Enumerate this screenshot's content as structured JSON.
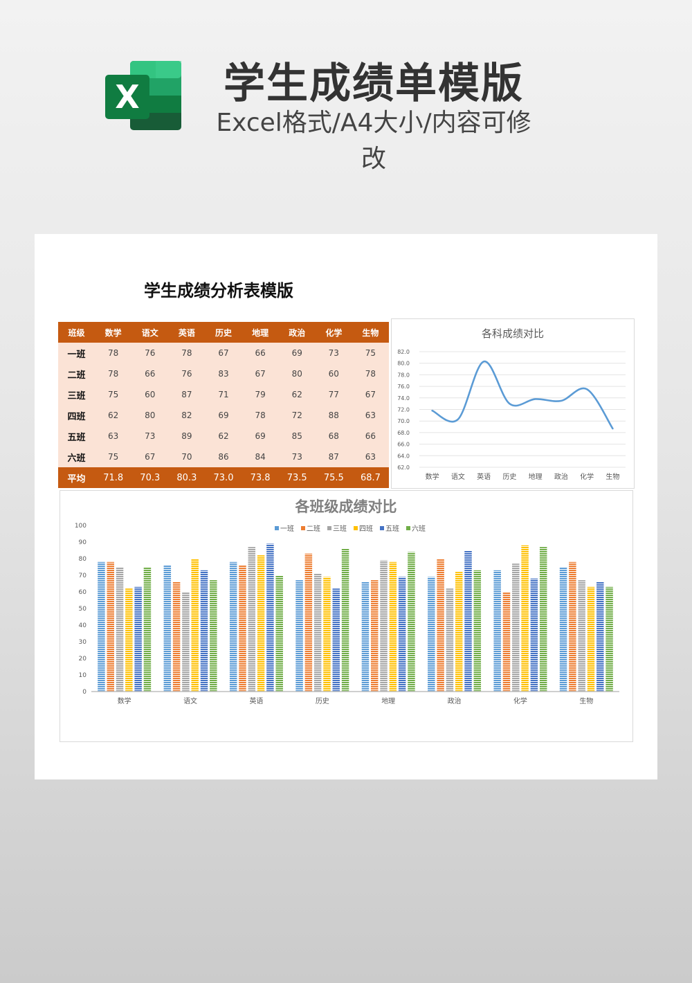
{
  "header": {
    "title": "学生成绩单模版",
    "subtitle": "Excel格式/A4大小/内容可修改",
    "logo_letter": "X",
    "logo_icon": "excel-logo-icon",
    "colors": {
      "dark_green": "#1e7145",
      "mid_green": "#21a366",
      "light_green": "#33c481"
    }
  },
  "sheet": {
    "title": "学生成绩分析表模版"
  },
  "table": {
    "header_bg": "#c55a11",
    "body_bg": "#fbe3d6",
    "columns": [
      "班级",
      "数学",
      "语文",
      "英语",
      "历史",
      "地理",
      "政治",
      "化学",
      "生物"
    ],
    "rows": [
      {
        "name": "一班",
        "values": [
          "78",
          "76",
          "78",
          "67",
          "66",
          "69",
          "73",
          "75"
        ]
      },
      {
        "name": "二班",
        "values": [
          "78",
          "66",
          "76",
          "83",
          "67",
          "80",
          "60",
          "78"
        ]
      },
      {
        "name": "三班",
        "values": [
          "75",
          "60",
          "87",
          "71",
          "79",
          "62",
          "77",
          "67"
        ]
      },
      {
        "name": "四班",
        "values": [
          "62",
          "80",
          "82",
          "69",
          "78",
          "72",
          "88",
          "63"
        ]
      },
      {
        "name": "五班",
        "values": [
          "63",
          "73",
          "89",
          "62",
          "69",
          "85",
          "68",
          "66"
        ]
      },
      {
        "name": "六班",
        "values": [
          "75",
          "67",
          "70",
          "86",
          "84",
          "73",
          "87",
          "63"
        ]
      }
    ],
    "average": {
      "name": "平均",
      "values": [
        "71.8",
        "70.3",
        "80.3",
        "73.0",
        "73.8",
        "73.5",
        "75.5",
        "68.7"
      ]
    }
  },
  "chart_data": [
    {
      "type": "line",
      "title": "各科成绩对比",
      "categories": [
        "数学",
        "语文",
        "英语",
        "历史",
        "地理",
        "政治",
        "化学",
        "生物"
      ],
      "values": [
        71.8,
        70.3,
        80.3,
        73.0,
        73.8,
        73.5,
        75.5,
        68.7
      ],
      "ylim": [
        62,
        82
      ],
      "yticks": [
        "82.0",
        "80.0",
        "78.0",
        "76.0",
        "74.0",
        "72.0",
        "70.0",
        "68.0",
        "66.0",
        "64.0",
        "62.0"
      ],
      "smooth": true,
      "grid": true,
      "legend": "none",
      "color": "#5b9bd5"
    },
    {
      "type": "bar",
      "title": "各班级成绩对比",
      "categories": [
        "数学",
        "语文",
        "英语",
        "历史",
        "地理",
        "政治",
        "化学",
        "生物"
      ],
      "series": [
        {
          "name": "一班",
          "color": "#5b9bd5",
          "values": [
            78,
            76,
            78,
            67,
            66,
            69,
            73,
            75
          ]
        },
        {
          "name": "二班",
          "color": "#ed7d31",
          "values": [
            78,
            66,
            76,
            83,
            67,
            80,
            60,
            78
          ]
        },
        {
          "name": "三班",
          "color": "#a5a5a5",
          "values": [
            75,
            60,
            87,
            71,
            79,
            62,
            77,
            67
          ]
        },
        {
          "name": "四班",
          "color": "#ffc000",
          "values": [
            62,
            80,
            82,
            69,
            78,
            72,
            88,
            63
          ]
        },
        {
          "name": "五班",
          "color": "#4472c4",
          "values": [
            63,
            73,
            89,
            62,
            69,
            85,
            68,
            66
          ]
        },
        {
          "name": "六班",
          "color": "#70ad47",
          "values": [
            75,
            67,
            70,
            86,
            84,
            73,
            87,
            63
          ]
        }
      ],
      "ylim": [
        0,
        100
      ],
      "yticks": [
        "100",
        "90",
        "80",
        "70",
        "60",
        "50",
        "40",
        "30",
        "20",
        "10",
        "0"
      ],
      "grid": false,
      "legend": "top-center",
      "bar_pattern": "horizontal-stripes"
    }
  ]
}
